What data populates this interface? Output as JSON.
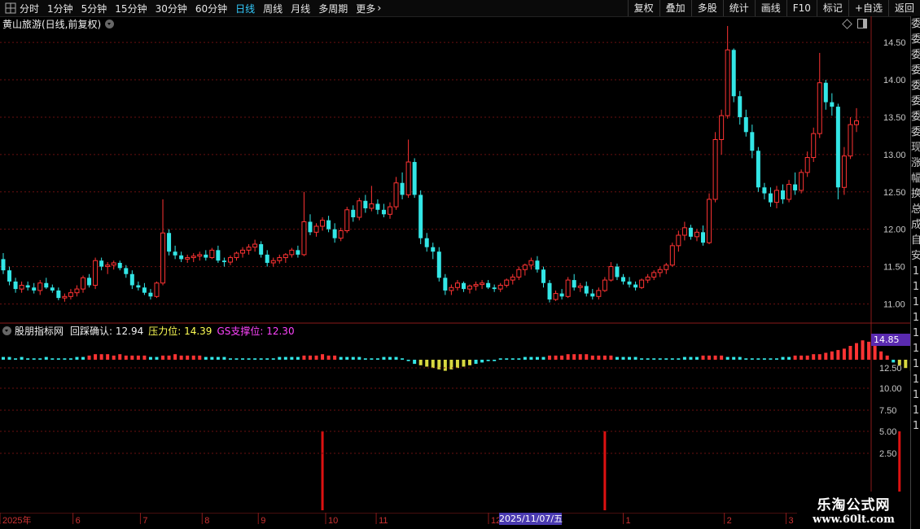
{
  "toolbar": {
    "periods": [
      {
        "label": "分时",
        "active": false
      },
      {
        "label": "1分钟",
        "active": false
      },
      {
        "label": "5分钟",
        "active": false
      },
      {
        "label": "15分钟",
        "active": false
      },
      {
        "label": "30分钟",
        "active": false
      },
      {
        "label": "60分钟",
        "active": false
      },
      {
        "label": "日线",
        "active": true
      },
      {
        "label": "周线",
        "active": false
      },
      {
        "label": "月线",
        "active": false
      },
      {
        "label": "多周期",
        "active": false
      },
      {
        "label": "更多",
        "active": false
      }
    ],
    "tools": [
      "复权",
      "叠加",
      "多股",
      "统计",
      "画线",
      "F10",
      "标记",
      "+自选",
      "返回"
    ]
  },
  "stock_title": "黄山旅游(日线,前复权)",
  "indicator": {
    "name": "股朋指标网",
    "legend1": "回踩确认: 12.94",
    "legend2": "压力位: 14.39",
    "legend3": "GS支撑位: 12.30",
    "axis_box": "14.85"
  },
  "highlight_date": "2025/11/07/五",
  "watermark": {
    "line1": "乐淘公式网",
    "line2": "www.60lt.com"
  },
  "right_strip_glyphs": [
    "委",
    "委",
    "委",
    "委",
    "委",
    "委",
    "委",
    "委",
    "现",
    "涨",
    "幅",
    "换",
    "总",
    "成",
    "自",
    "安",
    "1",
    "1",
    "1",
    "1",
    "1",
    "1",
    "1",
    "1",
    "1",
    "1",
    "1"
  ],
  "colors": {
    "up": "#ff3333",
    "down": "#33e6e6",
    "yellow": "#d8d840",
    "grid": "#6a1010",
    "axis_text": "#c8c8c8"
  },
  "chart_data": [
    {
      "type": "candlestick",
      "title": "黄山旅游(日线,前复权)",
      "y_ticks": [
        14.5,
        14.0,
        13.5,
        13.0,
        12.5,
        12.0,
        11.5,
        11.0
      ],
      "ylim": [
        10.82,
        14.85
      ],
      "x_labels": [
        "2025年",
        "6",
        "7",
        "8",
        "9",
        "10",
        "11",
        "2025/11/07/五",
        "12",
        "1",
        "2",
        "3"
      ],
      "ohlc": [
        [
          11.6,
          11.68,
          11.4,
          11.45
        ],
        [
          11.45,
          11.5,
          11.25,
          11.3
        ],
        [
          11.3,
          11.35,
          11.15,
          11.2
        ],
        [
          11.2,
          11.3,
          11.15,
          11.25
        ],
        [
          11.25,
          11.3,
          11.18,
          11.22
        ],
        [
          11.22,
          11.28,
          11.14,
          11.18
        ],
        [
          11.18,
          11.32,
          11.12,
          11.28
        ],
        [
          11.28,
          11.35,
          11.2,
          11.22
        ],
        [
          11.22,
          11.26,
          11.15,
          11.18
        ],
        [
          11.18,
          11.22,
          11.05,
          11.08
        ],
        [
          11.08,
          11.14,
          11.03,
          11.1
        ],
        [
          11.1,
          11.2,
          11.06,
          11.15
        ],
        [
          11.15,
          11.25,
          11.1,
          11.2
        ],
        [
          11.2,
          11.38,
          11.15,
          11.35
        ],
        [
          11.35,
          11.4,
          11.22,
          11.25
        ],
        [
          11.25,
          11.62,
          11.2,
          11.58
        ],
        [
          11.58,
          11.62,
          11.45,
          11.5
        ],
        [
          11.5,
          11.56,
          11.4,
          11.52
        ],
        [
          11.52,
          11.58,
          11.46,
          11.55
        ],
        [
          11.55,
          11.58,
          11.45,
          11.48
        ],
        [
          11.48,
          11.52,
          11.35,
          11.4
        ],
        [
          11.4,
          11.45,
          11.2,
          11.25
        ],
        [
          11.25,
          11.3,
          11.18,
          11.22
        ],
        [
          11.22,
          11.28,
          11.12,
          11.15
        ],
        [
          11.15,
          11.2,
          11.06,
          11.1
        ],
        [
          11.1,
          11.3,
          11.08,
          11.28
        ],
        [
          11.28,
          12.4,
          11.25,
          11.95
        ],
        [
          11.95,
          12.0,
          11.65,
          11.7
        ],
        [
          11.7,
          11.78,
          11.6,
          11.65
        ],
        [
          11.65,
          11.7,
          11.56,
          11.6
        ],
        [
          11.6,
          11.66,
          11.55,
          11.62
        ],
        [
          11.62,
          11.68,
          11.56,
          11.64
        ],
        [
          11.64,
          11.7,
          11.58,
          11.66
        ],
        [
          11.66,
          11.72,
          11.58,
          11.62
        ],
        [
          11.62,
          11.75,
          11.6,
          11.72
        ],
        [
          11.72,
          11.78,
          11.55,
          11.58
        ],
        [
          11.58,
          11.62,
          11.5,
          11.56
        ],
        [
          11.56,
          11.65,
          11.52,
          11.62
        ],
        [
          11.62,
          11.7,
          11.58,
          11.68
        ],
        [
          11.68,
          11.76,
          11.62,
          11.72
        ],
        [
          11.72,
          11.8,
          11.66,
          11.76
        ],
        [
          11.76,
          11.86,
          11.7,
          11.8
        ],
        [
          11.8,
          11.84,
          11.62,
          11.66
        ],
        [
          11.66,
          11.72,
          11.5,
          11.55
        ],
        [
          11.55,
          11.62,
          11.5,
          11.58
        ],
        [
          11.58,
          11.66,
          11.54,
          11.62
        ],
        [
          11.62,
          11.68,
          11.55,
          11.66
        ],
        [
          11.66,
          11.75,
          11.62,
          11.72
        ],
        [
          11.72,
          11.78,
          11.62,
          11.66
        ],
        [
          11.66,
          12.5,
          11.64,
          12.1
        ],
        [
          12.1,
          12.2,
          11.92,
          11.96
        ],
        [
          11.96,
          12.08,
          11.9,
          12.04
        ],
        [
          12.04,
          12.16,
          11.98,
          12.12
        ],
        [
          12.12,
          12.18,
          11.96,
          12.0
        ],
        [
          12.0,
          12.08,
          11.82,
          11.88
        ],
        [
          11.88,
          12.02,
          11.84,
          11.98
        ],
        [
          11.98,
          12.3,
          11.95,
          12.26
        ],
        [
          12.26,
          12.32,
          12.1,
          12.16
        ],
        [
          12.16,
          12.42,
          12.12,
          12.38
        ],
        [
          12.38,
          12.46,
          12.22,
          12.28
        ],
        [
          12.28,
          12.58,
          12.24,
          12.34
        ],
        [
          12.34,
          12.4,
          12.2,
          12.26
        ],
        [
          12.26,
          12.34,
          12.16,
          12.2
        ],
        [
          12.2,
          12.36,
          12.14,
          12.3
        ],
        [
          12.3,
          12.7,
          12.26,
          12.62
        ],
        [
          12.62,
          12.76,
          12.4,
          12.46
        ],
        [
          12.46,
          13.2,
          12.42,
          12.9
        ],
        [
          12.9,
          12.95,
          12.42,
          12.46
        ],
        [
          12.46,
          12.52,
          11.8,
          11.88
        ],
        [
          11.88,
          11.95,
          11.7,
          11.76
        ],
        [
          11.76,
          11.82,
          11.6,
          11.7
        ],
        [
          11.7,
          11.76,
          11.3,
          11.35
        ],
        [
          11.35,
          11.4,
          11.12,
          11.18
        ],
        [
          11.18,
          11.26,
          11.12,
          11.22
        ],
        [
          11.22,
          11.32,
          11.18,
          11.28
        ],
        [
          11.28,
          11.3,
          11.16,
          11.2
        ],
        [
          11.2,
          11.26,
          11.14,
          11.24
        ],
        [
          11.24,
          11.3,
          11.18,
          11.26
        ],
        [
          11.26,
          11.32,
          11.2,
          11.28
        ],
        [
          11.28,
          11.32,
          11.2,
          11.22
        ],
        [
          11.22,
          11.26,
          11.16,
          11.2
        ],
        [
          11.2,
          11.28,
          11.16,
          11.25
        ],
        [
          11.25,
          11.34,
          11.22,
          11.32
        ],
        [
          11.32,
          11.4,
          11.26,
          11.36
        ],
        [
          11.36,
          11.5,
          11.32,
          11.46
        ],
        [
          11.46,
          11.54,
          11.38,
          11.52
        ],
        [
          11.52,
          11.62,
          11.46,
          11.58
        ],
        [
          11.58,
          11.64,
          11.42,
          11.46
        ],
        [
          11.46,
          11.5,
          11.22,
          11.28
        ],
        [
          11.28,
          11.32,
          11.02,
          11.06
        ],
        [
          11.06,
          11.18,
          11.04,
          11.14
        ],
        [
          11.14,
          11.2,
          11.06,
          11.1
        ],
        [
          11.1,
          11.36,
          11.08,
          11.32
        ],
        [
          11.32,
          11.4,
          11.18,
          11.22
        ],
        [
          11.22,
          11.28,
          11.16,
          11.24
        ],
        [
          11.24,
          11.3,
          11.1,
          11.14
        ],
        [
          11.14,
          11.2,
          11.06,
          11.1
        ],
        [
          11.1,
          11.22,
          11.06,
          11.18
        ],
        [
          11.18,
          11.36,
          11.16,
          11.32
        ],
        [
          11.32,
          11.56,
          11.3,
          11.5
        ],
        [
          11.5,
          11.54,
          11.32,
          11.36
        ],
        [
          11.36,
          11.4,
          11.26,
          11.3
        ],
        [
          11.3,
          11.36,
          11.22,
          11.26
        ],
        [
          11.26,
          11.3,
          11.18,
          11.22
        ],
        [
          11.22,
          11.34,
          11.2,
          11.32
        ],
        [
          11.32,
          11.4,
          11.28,
          11.36
        ],
        [
          11.36,
          11.45,
          11.32,
          11.42
        ],
        [
          11.42,
          11.5,
          11.36,
          11.46
        ],
        [
          11.46,
          11.55,
          11.4,
          11.52
        ],
        [
          11.52,
          11.82,
          11.5,
          11.78
        ],
        [
          11.78,
          11.98,
          11.7,
          11.92
        ],
        [
          11.92,
          12.1,
          11.85,
          12.02
        ],
        [
          12.02,
          12.06,
          11.86,
          11.9
        ],
        [
          11.9,
          12.0,
          11.84,
          11.96
        ],
        [
          11.96,
          12.05,
          11.78,
          11.82
        ],
        [
          11.82,
          12.48,
          11.8,
          12.4
        ],
        [
          12.4,
          13.3,
          12.36,
          13.2
        ],
        [
          13.2,
          13.6,
          13.0,
          13.52
        ],
        [
          13.52,
          14.72,
          13.48,
          14.4
        ],
        [
          14.4,
          14.42,
          13.7,
          13.78
        ],
        [
          13.78,
          13.85,
          13.4,
          13.5
        ],
        [
          13.5,
          13.6,
          13.24,
          13.3
        ],
        [
          13.3,
          13.4,
          12.95,
          13.05
        ],
        [
          13.05,
          13.1,
          12.5,
          12.56
        ],
        [
          12.56,
          12.62,
          12.4,
          12.48
        ],
        [
          12.48,
          12.56,
          12.3,
          12.36
        ],
        [
          12.36,
          12.58,
          12.28,
          12.52
        ],
        [
          12.52,
          12.6,
          12.34,
          12.4
        ],
        [
          12.4,
          12.66,
          12.36,
          12.6
        ],
        [
          12.6,
          12.76,
          12.46,
          12.52
        ],
        [
          12.52,
          12.8,
          12.48,
          12.76
        ],
        [
          12.76,
          13.04,
          12.7,
          12.96
        ],
        [
          12.96,
          13.36,
          12.9,
          13.28
        ],
        [
          13.28,
          14.36,
          13.22,
          13.96
        ],
        [
          13.96,
          14.0,
          13.6,
          13.7
        ],
        [
          13.7,
          13.82,
          13.52,
          13.64
        ],
        [
          13.64,
          13.68,
          12.4,
          12.56
        ],
        [
          12.56,
          13.1,
          12.46,
          12.98
        ],
        [
          12.98,
          13.5,
          12.94,
          13.4
        ],
        [
          13.4,
          13.62,
          13.3,
          13.45
        ]
      ]
    },
    {
      "type": "bar",
      "title": "股朋指标网",
      "y_ticks": [
        12.5,
        10.0,
        7.5,
        5.0,
        2.5
      ],
      "signals_at_index": [
        52,
        98,
        146
      ],
      "osc": [
        2,
        2,
        1,
        2,
        1,
        1,
        1,
        2,
        1,
        1,
        1,
        1,
        2,
        2,
        3,
        4,
        4,
        4,
        3,
        4,
        3,
        3,
        3,
        3,
        2,
        2,
        3,
        3,
        4,
        3,
        3,
        3,
        3,
        2,
        2,
        2,
        2,
        1,
        1,
        1,
        1,
        1,
        1,
        1,
        1,
        2,
        2,
        2,
        2,
        3,
        3,
        3,
        4,
        3,
        3,
        2,
        2,
        2,
        2,
        1,
        1,
        1,
        2,
        2,
        2,
        1,
        -1,
        -3,
        -4,
        -5,
        -6,
        -7,
        -8,
        -7,
        -6,
        -5,
        -4,
        -3,
        -2,
        -1,
        -1,
        1,
        1,
        1,
        1,
        2,
        2,
        2,
        2,
        3,
        3,
        3,
        4,
        4,
        4,
        4,
        3,
        3,
        3,
        3,
        2,
        2,
        2,
        2,
        1,
        1,
        1,
        1,
        1,
        1,
        1,
        2,
        2,
        2,
        3,
        3,
        3,
        3,
        2,
        2,
        2,
        1,
        1,
        1,
        1,
        1,
        1,
        2,
        2,
        3,
        3,
        3,
        4,
        4,
        5,
        6,
        7,
        8,
        10,
        12,
        14,
        13,
        10,
        6,
        3,
        -2,
        -4,
        -6,
        -8,
        -9,
        -10,
        -9,
        -8,
        -6,
        -4,
        -2,
        1,
        3,
        5,
        6,
        6,
        5,
        3,
        2,
        1
      ]
    }
  ]
}
